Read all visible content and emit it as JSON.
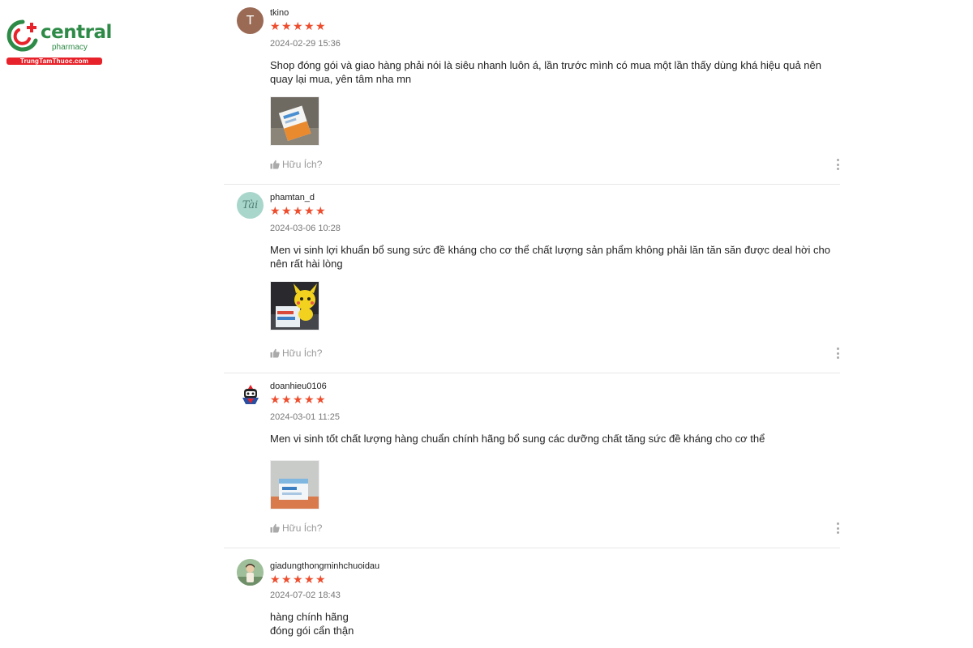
{
  "brand": {
    "name": "central",
    "sub": "pharmacy",
    "site": "TrungTamThuoc.com",
    "color_green": "#2e8b47",
    "color_red": "#e8222a"
  },
  "accent_star_color": "#ee4d2d",
  "reviews": [
    {
      "avatar_letter": "T",
      "username": "tkino",
      "rating": 5,
      "date": "2024-02-29 15:36",
      "comment": "Shop đóng gói và giao hàng phải nói là siêu nhanh luôn á, lần trước mình có mua một lần thấy dùng khá hiệu quả nên quay lại mua, yên tâm nha mn",
      "helpful_label": "Hữu Ích?"
    },
    {
      "avatar_letter": "Tài",
      "username": "phamtan_d",
      "rating": 5,
      "date": "2024-03-06 10:28",
      "comment": "Men vi sinh lợi khuẩn bổ sung sức đề kháng cho cơ thể chất lượng sản phẩm không phải lăn tăn săn được deal hời cho nên rất hài lòng",
      "helpful_label": "Hữu Ích?"
    },
    {
      "username": "doanhieu0106",
      "rating": 5,
      "date": "2024-03-01 11:25",
      "comment": "Men vi sinh tốt chất lượng hàng chuẩn chính hãng bổ sung các dưỡng chất tăng sức đề kháng cho cơ thể",
      "helpful_label": "Hữu Ích?"
    },
    {
      "username": "giadungthongminhchuoidau",
      "rating": 5,
      "date": "2024-07-02 18:43",
      "comment_line1": "hàng chính hãng",
      "comment_line2": "đóng gói cẩn thận"
    }
  ]
}
